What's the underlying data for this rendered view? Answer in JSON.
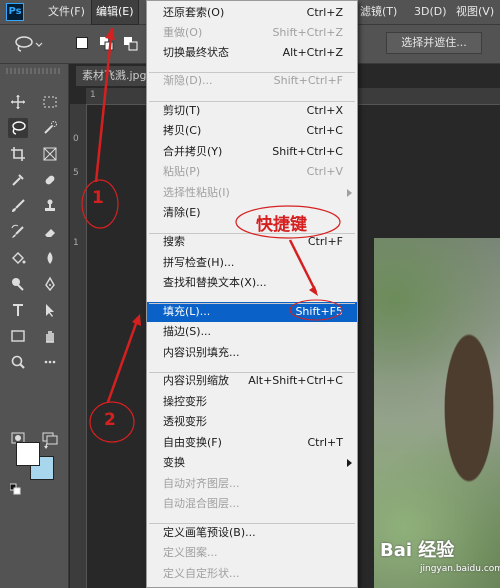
{
  "app_logo": "Ps",
  "menubar": {
    "items": [
      {
        "label": "文件(F)"
      },
      {
        "label": "编辑(E)"
      },
      {
        "label": "滤镜(T)"
      },
      {
        "label": "3D(D)"
      },
      {
        "label": "视图(V)"
      }
    ]
  },
  "options_bar": {
    "select_and_mask": "选择并遮住..."
  },
  "document": {
    "tab_title": "素材飞溅.jpg",
    "ruler_marks": [
      "1",
      "0",
      "5",
      "1"
    ]
  },
  "edit_menu": {
    "items": [
      {
        "label": "还原套索(O)",
        "shortcut": "Ctrl+Z",
        "disabled": false
      },
      {
        "label": "重做(O)",
        "shortcut": "Shift+Ctrl+Z",
        "disabled": true
      },
      {
        "label": "切换最终状态",
        "shortcut": "Alt+Ctrl+Z",
        "disabled": false
      },
      {
        "label": "渐隐(D)...",
        "shortcut": "Shift+Ctrl+F",
        "disabled": true
      },
      {
        "label": "剪切(T)",
        "shortcut": "Ctrl+X",
        "disabled": false
      },
      {
        "label": "拷贝(C)",
        "shortcut": "Ctrl+C",
        "disabled": false
      },
      {
        "label": "合并拷贝(Y)",
        "shortcut": "Shift+Ctrl+C",
        "disabled": false
      },
      {
        "label": "粘贴(P)",
        "shortcut": "Ctrl+V",
        "disabled": true
      },
      {
        "label": "选择性粘贴(I)",
        "shortcut": "",
        "disabled": true,
        "submenu": true
      },
      {
        "label": "清除(E)",
        "shortcut": "",
        "disabled": false
      },
      {
        "label": "搜索",
        "shortcut": "Ctrl+F",
        "disabled": false
      },
      {
        "label": "拼写检查(H)...",
        "shortcut": "",
        "disabled": false
      },
      {
        "label": "查找和替换文本(X)...",
        "shortcut": "",
        "disabled": false
      },
      {
        "label": "填充(L)...",
        "shortcut": "Shift+F5",
        "disabled": false,
        "highlighted": true
      },
      {
        "label": "描边(S)...",
        "shortcut": "",
        "disabled": false
      },
      {
        "label": "内容识别填充...",
        "shortcut": "",
        "disabled": false
      },
      {
        "label": "内容识别缩放",
        "shortcut": "Alt+Shift+Ctrl+C",
        "disabled": false
      },
      {
        "label": "操控变形",
        "shortcut": "",
        "disabled": false
      },
      {
        "label": "透视变形",
        "shortcut": "",
        "disabled": false
      },
      {
        "label": "自由变换(F)",
        "shortcut": "Ctrl+T",
        "disabled": false
      },
      {
        "label": "变换",
        "shortcut": "",
        "disabled": false,
        "submenu": true
      },
      {
        "label": "自动对齐图层...",
        "shortcut": "",
        "disabled": true
      },
      {
        "label": "自动混合图层...",
        "shortcut": "",
        "disabled": true
      },
      {
        "label": "定义画笔预设(B)...",
        "shortcut": "",
        "disabled": false
      },
      {
        "label": "定义图案...",
        "shortcut": "",
        "disabled": true
      },
      {
        "label": "定义自定形状...",
        "shortcut": "",
        "disabled": true
      }
    ]
  },
  "annotations": {
    "shortcut_note": "快捷键",
    "step1": "1",
    "step2": "2",
    "color": "#d62020"
  },
  "watermark": {
    "main": "Bai 经验",
    "sub": "jingyan.baidu.com"
  },
  "colors": {
    "highlight": "#0a62c8",
    "foreground_swatch": "#ffffff",
    "background_swatch": "#a8d6ec",
    "ps_blue": "#31a8ff"
  }
}
